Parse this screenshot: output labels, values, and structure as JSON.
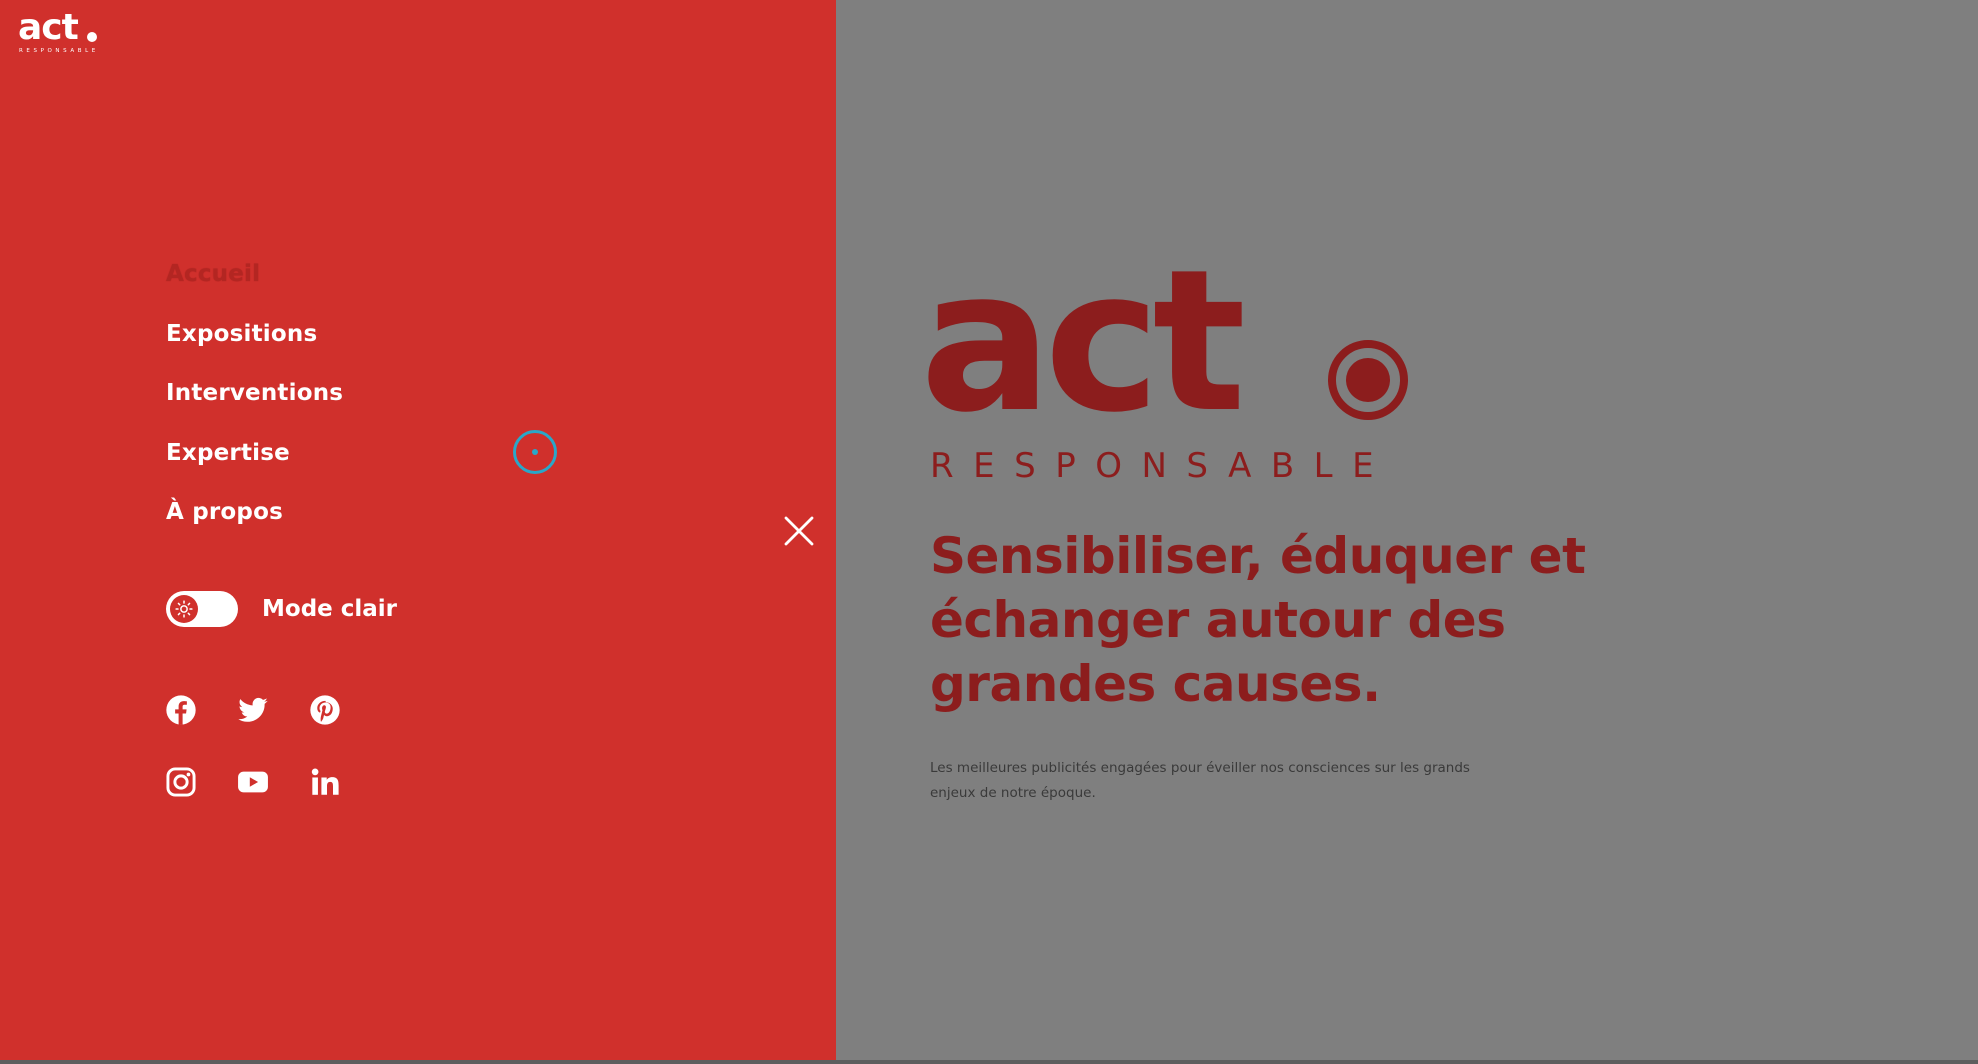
{
  "brand": {
    "name": "act",
    "subtitle": "RESPONSABLE"
  },
  "menu": {
    "items": [
      {
        "label": "Accueil",
        "active": true
      },
      {
        "label": "Expositions",
        "active": false
      },
      {
        "label": "Interventions",
        "active": false
      },
      {
        "label": "Expertise",
        "active": false
      },
      {
        "label": "À propos",
        "active": false
      }
    ],
    "mode_toggle": {
      "label": "Mode clair",
      "icon": "sun-icon"
    },
    "social": [
      {
        "name": "facebook-icon"
      },
      {
        "name": "twitter-icon"
      },
      {
        "name": "pinterest-icon"
      },
      {
        "name": "instagram-icon"
      },
      {
        "name": "youtube-icon"
      },
      {
        "name": "linkedin-icon"
      }
    ],
    "close_icon": "close-icon"
  },
  "hero": {
    "logo_word": "act",
    "logo_subtitle": "RESPONSABLE",
    "headline": "Sensibiliser, éduquer et échanger autour des grandes causes.",
    "tagline": "Les meilleures publicités engagées pour éveiller nos consciences sur les grands enjeux de notre époque."
  },
  "colors": {
    "panel_red": "#d0302c",
    "overlay_grey": "#7f7f7f",
    "hero_dark_red": "#8c1d1d",
    "cursor_cyan": "#2aa7c9"
  }
}
